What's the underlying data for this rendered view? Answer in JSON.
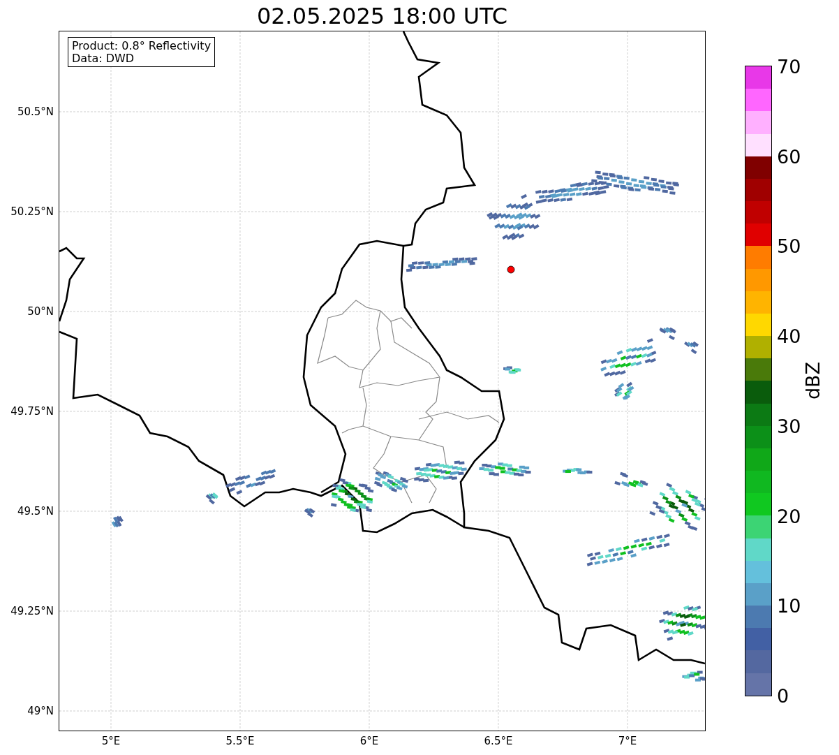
{
  "title": "02.05.2025 18:00 UTC",
  "info_box": [
    "Product: 0.8° Reflectivity",
    "Data: DWD"
  ],
  "map": {
    "xticks": [
      "5°E",
      "5.5°E",
      "6°E",
      "6.5°E",
      "7°E"
    ],
    "yticks": [
      "50.5°N",
      "50.25°N",
      "50°N",
      "49.75°N",
      "49.5°N",
      "49.25°N",
      "49°N"
    ]
  },
  "colorbar": {
    "label": "dBZ",
    "ticks": [
      "70",
      "60",
      "50",
      "40",
      "30",
      "20",
      "10",
      "0"
    ],
    "bins": [
      {
        "color": "#e838e8"
      },
      {
        "color": "#ff66ff"
      },
      {
        "color": "#ffb0ff"
      },
      {
        "color": "#ffe0ff"
      },
      {
        "color": "#800000"
      },
      {
        "color": "#a00000"
      },
      {
        "color": "#c00000"
      },
      {
        "color": "#e00000"
      },
      {
        "color": "#ff7c00"
      },
      {
        "color": "#ff9800"
      },
      {
        "color": "#ffb400"
      },
      {
        "color": "#ffd800"
      },
      {
        "color": "#b0b000"
      },
      {
        "color": "#4a7a0a"
      },
      {
        "color": "#0a5c0c"
      },
      {
        "color": "#0c7a14"
      },
      {
        "color": "#0c9018"
      },
      {
        "color": "#10a818"
      },
      {
        "color": "#10b820"
      },
      {
        "color": "#10c820"
      },
      {
        "color": "#3cd474"
      },
      {
        "color": "#60d8c8"
      },
      {
        "color": "#64c0dc"
      },
      {
        "color": "#5aa0c8"
      },
      {
        "color": "#4c7ab0"
      },
      {
        "color": "#4260a4"
      },
      {
        "color": "#5468a0"
      },
      {
        "color": "#6574a8"
      }
    ]
  }
}
